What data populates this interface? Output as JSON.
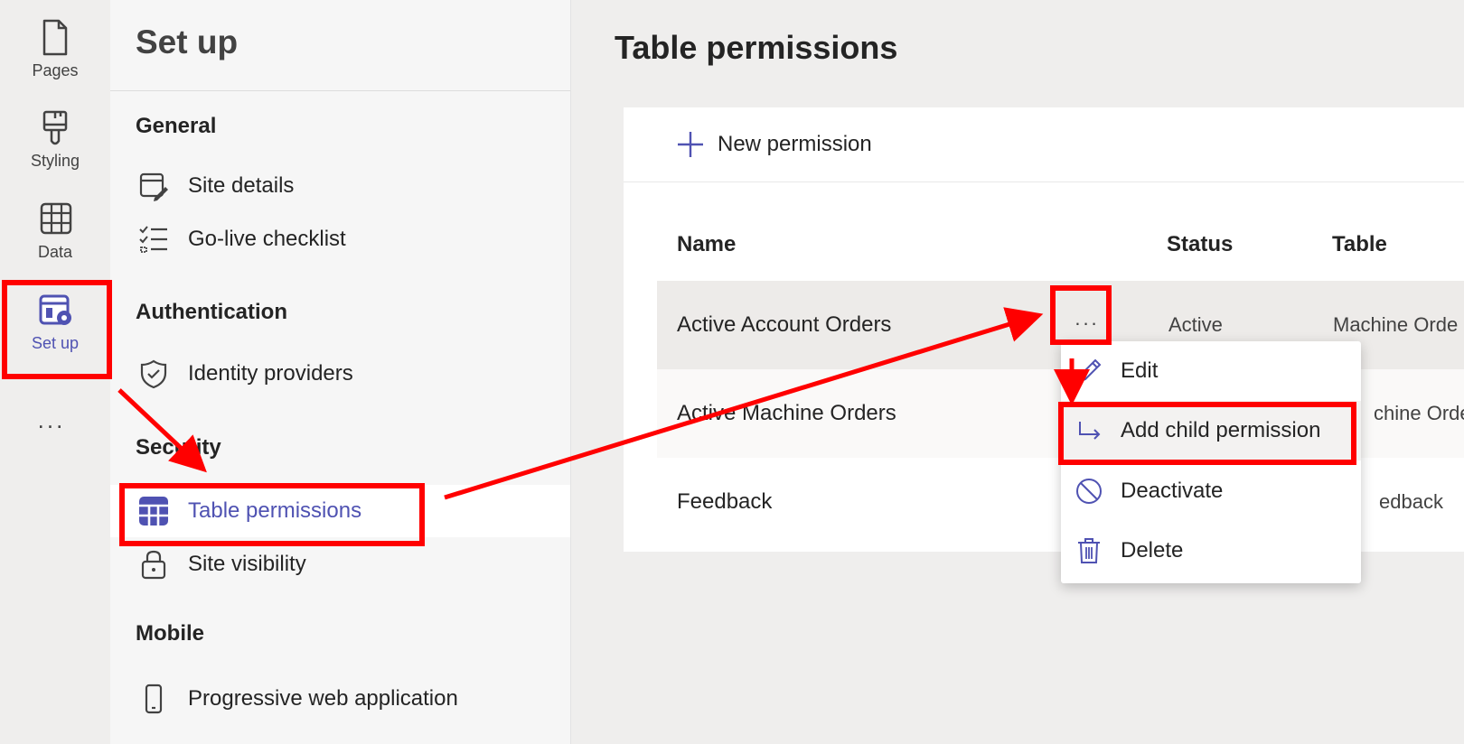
{
  "rail": {
    "items": [
      {
        "label": "Pages",
        "icon": "page-icon"
      },
      {
        "label": "Styling",
        "icon": "paintbrush-icon"
      },
      {
        "label": "Data",
        "icon": "table-grid-icon"
      },
      {
        "label": "Set up",
        "icon": "setup-gear-icon",
        "active": true
      }
    ],
    "more": "..."
  },
  "setup": {
    "title": "Set up",
    "sections": {
      "general": "General",
      "authentication": "Authentication",
      "security": "Security",
      "mobile": "Mobile"
    },
    "items": {
      "site_details": "Site details",
      "go_live": "Go-live checklist",
      "identity": "Identity providers",
      "table_permissions": "Table permissions",
      "site_visibility": "Site visibility",
      "pwa": "Progressive web application"
    }
  },
  "main": {
    "title": "Table permissions",
    "new_permission": "New permission",
    "columns": {
      "name": "Name",
      "status": "Status",
      "table": "Table"
    },
    "rows": [
      {
        "name": "Active Account Orders",
        "status": "Active",
        "table": "Machine Orde"
      },
      {
        "name": "Active Machine Orders",
        "status": "",
        "table": "chine Orde"
      },
      {
        "name": "Feedback",
        "status": "",
        "table": "edback"
      }
    ],
    "more": "..."
  },
  "menu": {
    "items": [
      {
        "label": "Edit",
        "icon": "pencil-icon"
      },
      {
        "label": "Add child permission",
        "icon": "child-arrow-icon"
      },
      {
        "label": "Deactivate",
        "icon": "block-icon"
      },
      {
        "label": "Delete",
        "icon": "trash-icon"
      }
    ]
  },
  "colors": {
    "accent": "#4f52b2",
    "annotation": "#ff0000",
    "rail_bg": "#efeeed",
    "panel_bg": "#f6f6f6"
  }
}
